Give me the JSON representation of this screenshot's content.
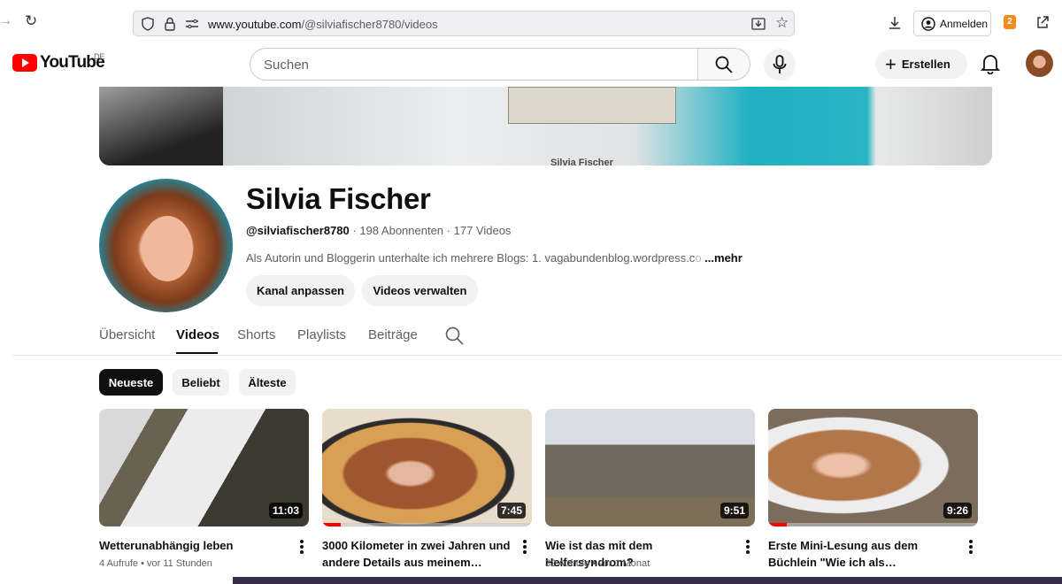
{
  "browser": {
    "url_domain": "www.youtube.com",
    "url_path": "/@silviafischer8780/videos",
    "signin_label": "Anmelden",
    "extension_badge": "2"
  },
  "header": {
    "logo_text": "YouTube",
    "region": "DE",
    "search_placeholder": "Suchen",
    "create_label": "Erstellen"
  },
  "banner": {
    "text": "Silvia Fischer"
  },
  "channel": {
    "name": "Silvia Fischer",
    "handle": "@silviafischer8780",
    "subscribers": "198 Abonnenten",
    "video_count": "177 Videos",
    "separator": " · ",
    "description": "Als Autorin und Bloggerin unterhalte ich mehrere Blogs: 1. vagabundenblog.wordpress.c",
    "description_faded": "o",
    "more": "...mehr",
    "customize_label": "Kanal anpassen",
    "manage_label": "Videos verwalten"
  },
  "tabs": [
    "Übersicht",
    "Videos",
    "Shorts",
    "Playlists",
    "Beiträge"
  ],
  "active_tab": "Videos",
  "chips": [
    "Neueste",
    "Beliebt",
    "Älteste"
  ],
  "active_chip": "Neueste",
  "videos": [
    {
      "title": "Wetterunabhängig leben",
      "duration": "11:03",
      "views": "4 Aufrufe",
      "age": "vor 11 Stunden",
      "progress": 0
    },
    {
      "title": "3000 Kilometer in zwei Jahren und andere Details aus meinem Leben…",
      "duration": "7:45",
      "views": "",
      "age": "",
      "progress": 0.09
    },
    {
      "title": "Wie ist das mit dem Helfersyndrom?",
      "duration": "9:51",
      "views": "32 Aufrufe",
      "age": "vor 1 Monat",
      "progress": 0
    },
    {
      "title": "Erste Mini-Lesung aus dem Büchlein \"Wie ich als Aussteigerin…",
      "duration": "9:26",
      "views": "",
      "age": "",
      "progress": 0.09
    }
  ],
  "meta_separator": " • ",
  "colors": {
    "brand_red": "#ff0000",
    "text": "#0f0f0f",
    "muted": "#606060",
    "chip_bg": "#f2f2f2"
  }
}
